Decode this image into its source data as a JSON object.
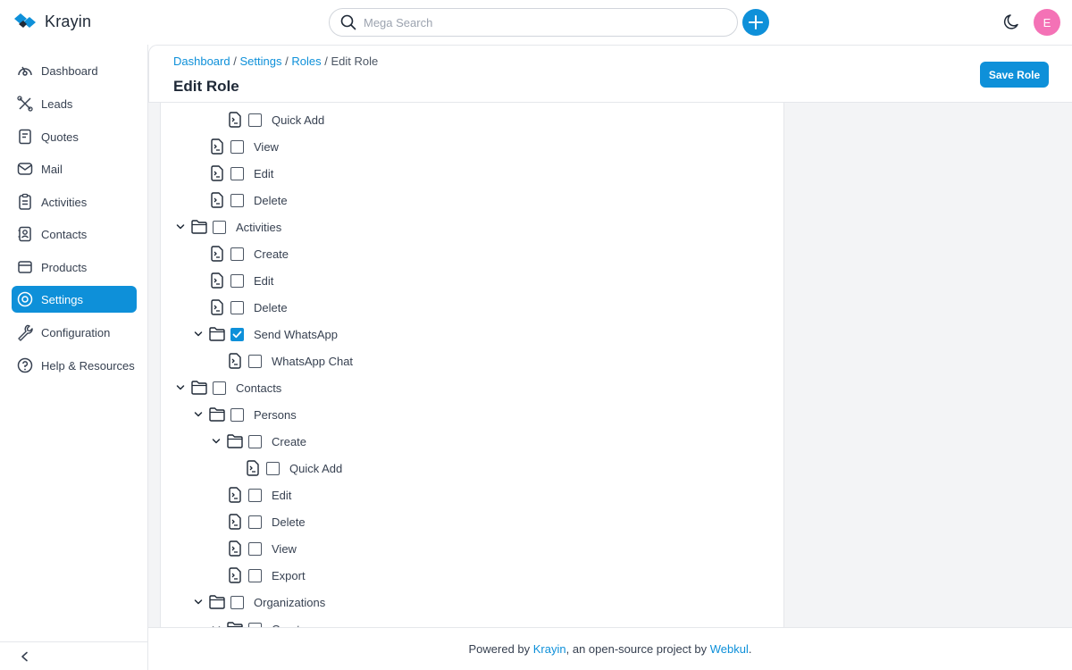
{
  "app": {
    "name": "Krayin",
    "brand_color": "#0e90d9",
    "avatar_color": "#f472b6"
  },
  "header": {
    "search_placeholder": "Mega Search",
    "avatar_initial": "E"
  },
  "sidebar": {
    "items": [
      {
        "label": "Dashboard",
        "icon": "dashboard-icon",
        "active": false
      },
      {
        "label": "Leads",
        "icon": "leads-icon",
        "active": false
      },
      {
        "label": "Quotes",
        "icon": "quotes-icon",
        "active": false
      },
      {
        "label": "Mail",
        "icon": "mail-icon",
        "active": false
      },
      {
        "label": "Activities",
        "icon": "activities-icon",
        "active": false
      },
      {
        "label": "Contacts",
        "icon": "contacts-icon",
        "active": false
      },
      {
        "label": "Products",
        "icon": "products-icon",
        "active": false
      },
      {
        "label": "Settings",
        "icon": "settings-icon",
        "active": true
      },
      {
        "label": "Configuration",
        "icon": "configuration-icon",
        "active": false
      },
      {
        "label": "Help & Resources",
        "icon": "help-icon",
        "active": false
      }
    ]
  },
  "page": {
    "breadcrumb": {
      "dashboard": "Dashboard",
      "settings": "Settings",
      "roles": "Roles",
      "current": "Edit Role",
      "sep": "/"
    },
    "title": "Edit Role",
    "save_label": "Save Role"
  },
  "tree": [
    {
      "label": "Quick Add",
      "depth": 2,
      "type": "file",
      "expanded": false,
      "checked": false
    },
    {
      "label": "View",
      "depth": 1,
      "type": "file",
      "expanded": false,
      "checked": false
    },
    {
      "label": "Edit",
      "depth": 1,
      "type": "file",
      "expanded": false,
      "checked": false
    },
    {
      "label": "Delete",
      "depth": 1,
      "type": "file",
      "expanded": false,
      "checked": false
    },
    {
      "label": "Activities",
      "depth": 0,
      "type": "folder",
      "expanded": true,
      "checked": false
    },
    {
      "label": "Create",
      "depth": 1,
      "type": "file",
      "expanded": false,
      "checked": false
    },
    {
      "label": "Edit",
      "depth": 1,
      "type": "file",
      "expanded": false,
      "checked": false
    },
    {
      "label": "Delete",
      "depth": 1,
      "type": "file",
      "expanded": false,
      "checked": false
    },
    {
      "label": "Send WhatsApp",
      "depth": 1,
      "type": "folder",
      "expanded": true,
      "checked": true
    },
    {
      "label": "WhatsApp Chat",
      "depth": 2,
      "type": "file",
      "expanded": false,
      "checked": false
    },
    {
      "label": "Contacts",
      "depth": 0,
      "type": "folder",
      "expanded": true,
      "checked": false
    },
    {
      "label": "Persons",
      "depth": 1,
      "type": "folder",
      "expanded": true,
      "checked": false
    },
    {
      "label": "Create",
      "depth": 2,
      "type": "folder",
      "expanded": true,
      "checked": false
    },
    {
      "label": "Quick Add",
      "depth": 3,
      "type": "file",
      "expanded": false,
      "checked": false
    },
    {
      "label": "Edit",
      "depth": 2,
      "type": "file",
      "expanded": false,
      "checked": false
    },
    {
      "label": "Delete",
      "depth": 2,
      "type": "file",
      "expanded": false,
      "checked": false
    },
    {
      "label": "View",
      "depth": 2,
      "type": "file",
      "expanded": false,
      "checked": false
    },
    {
      "label": "Export",
      "depth": 2,
      "type": "file",
      "expanded": false,
      "checked": false
    },
    {
      "label": "Organizations",
      "depth": 1,
      "type": "folder",
      "expanded": true,
      "checked": false
    },
    {
      "label": "Create",
      "depth": 2,
      "type": "folder",
      "expanded": true,
      "checked": false
    }
  ],
  "footer": {
    "prefix": "Powered by ",
    "krayin": "Krayin",
    "middle": ", an open-source project by ",
    "webkul": "Webkul",
    "suffix": "."
  }
}
